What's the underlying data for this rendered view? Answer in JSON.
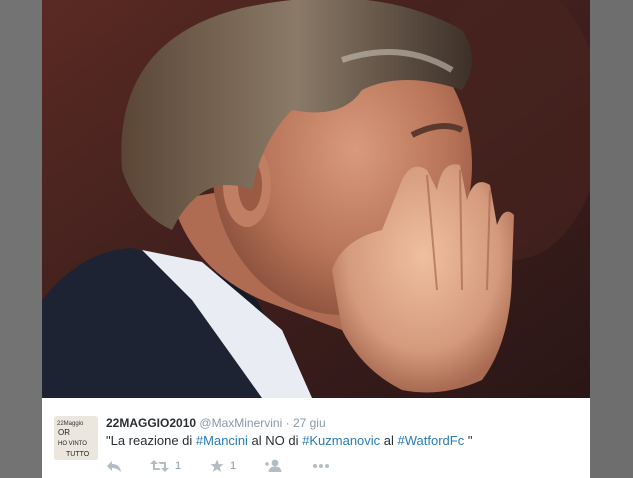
{
  "tweet": {
    "display_name": "22MAGGIO2010",
    "handle": "@MaxMinervini",
    "separator": "·",
    "time": "27 giu",
    "text_parts": [
      {
        "t": "\"La reazione di ",
        "tag": false
      },
      {
        "t": "#Mancini",
        "tag": true
      },
      {
        "t": " al NO di ",
        "tag": false
      },
      {
        "t": "#Kuzmanovic",
        "tag": true
      },
      {
        "t": " al ",
        "tag": false
      },
      {
        "t": "#WatfordFc",
        "tag": true
      },
      {
        "t": " \"",
        "tag": false
      }
    ],
    "avatar_text": [
      "22Maggio",
      "OR",
      "HO VINTO",
      "TUTTO"
    ],
    "actions": {
      "reply": {
        "icon": "reply-icon",
        "count": ""
      },
      "retweet": {
        "icon": "retweet-icon",
        "count": "1"
      },
      "favorite": {
        "icon": "star-icon",
        "count": "1"
      },
      "follow": {
        "icon": "follow-icon",
        "count": ""
      },
      "more": {
        "icon": "more-dots-icon",
        "count": ""
      }
    }
  },
  "colors": {
    "name": "#292f33",
    "muted": "#8899a6",
    "hashtag": "#2b7bb9",
    "background": "#6d6d6d"
  }
}
